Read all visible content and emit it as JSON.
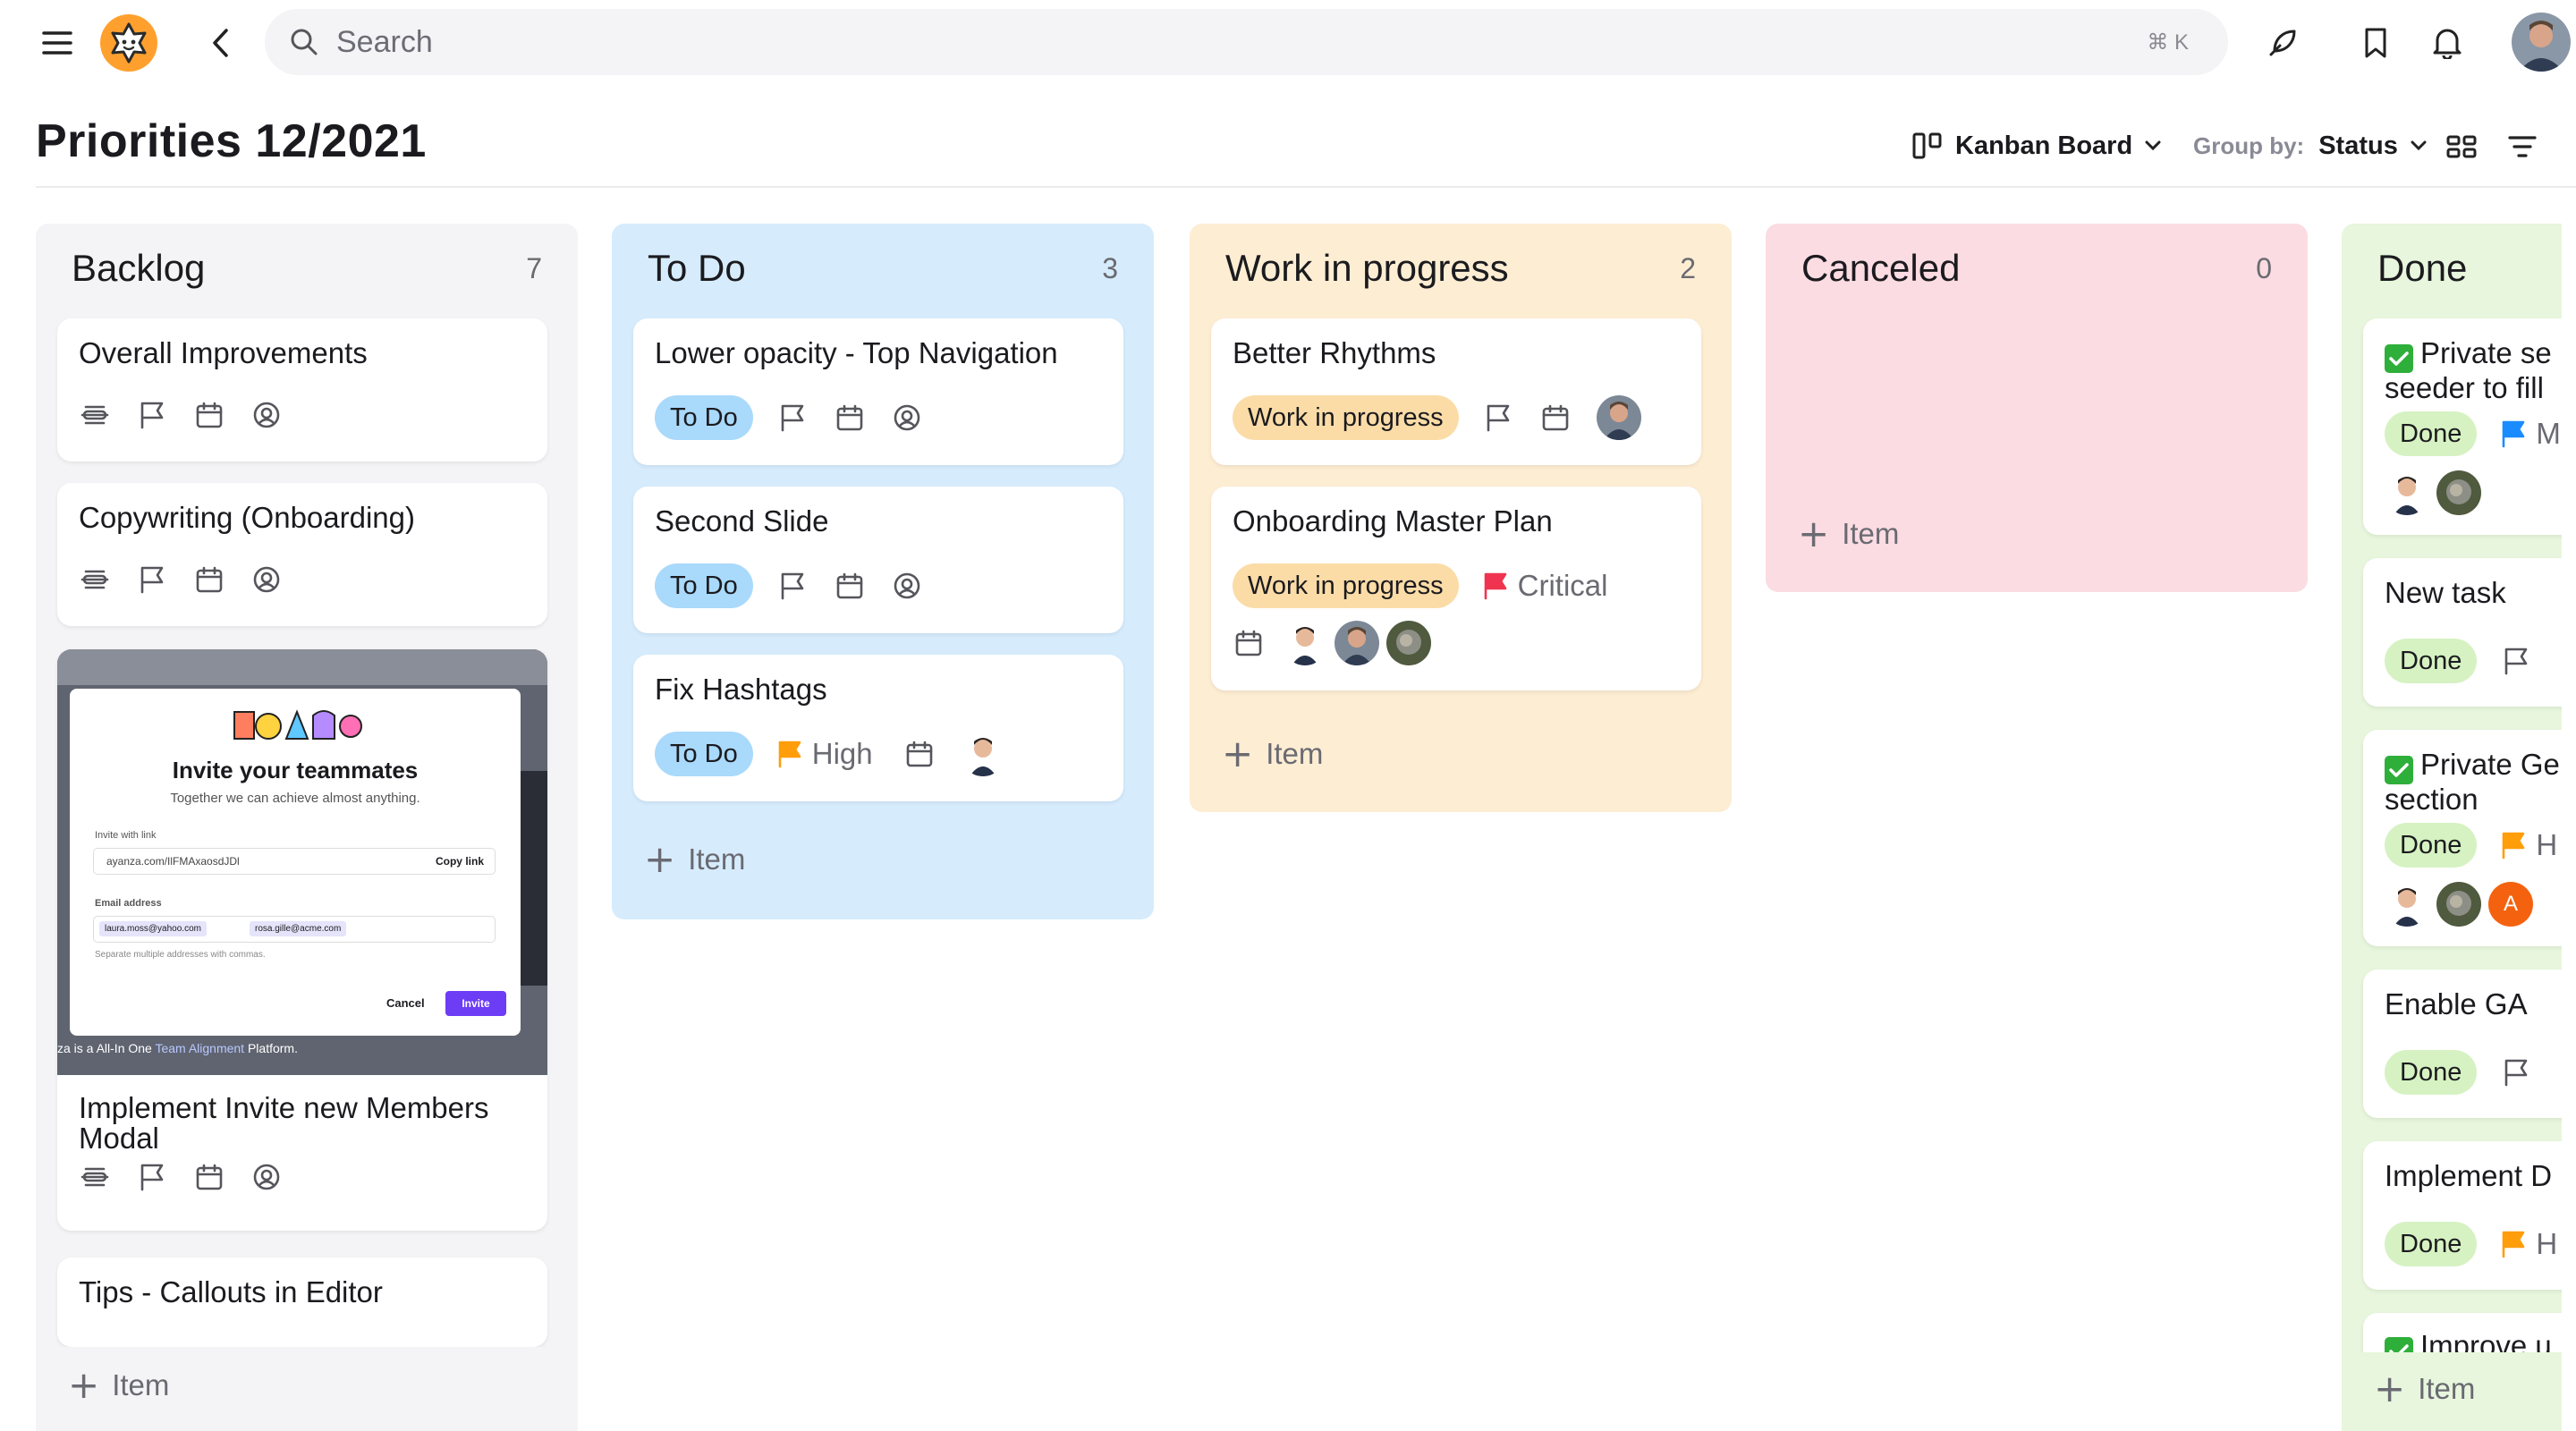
{
  "topbar": {
    "search_placeholder": "Search",
    "search_shortcut": "⌘ K"
  },
  "header": {
    "title": "Priorities 12/2021",
    "view_label": "Kanban Board",
    "group_by_label": "Group by:",
    "group_by_value": "Status"
  },
  "columns": {
    "backlog": {
      "title": "Backlog",
      "count": "7",
      "add_label": "Item",
      "cards": [
        {
          "title": "Overall Improvements"
        },
        {
          "title": "Copywriting (Onboarding)"
        },
        {
          "title": "Implement Invite new Members Modal",
          "preview": {
            "modal_title": "Invite your teammates",
            "subtitle": "Together we can achieve almost anything.",
            "link_label": "Invite with link",
            "link_value": "ayanza.com/IlFMAxaosdJDl",
            "copy_label": "Copy link",
            "email_label": "Email address",
            "chip_1": "laura.moss@yahoo.com",
            "chip_2": "rosa.gille@acme.com",
            "helper": "Separate multiple addresses with commas.",
            "cancel": "Cancel",
            "invite": "Invite",
            "footer_prefix": "za is a All-In One ",
            "footer_link": "Team Alignment",
            "footer_suffix": " Platform."
          }
        },
        {
          "title": "Tips - Callouts in Editor"
        }
      ]
    },
    "todo": {
      "title": "To Do",
      "count": "3",
      "add_label": "Item",
      "cards": [
        {
          "title": "Lower opacity - Top Navigation",
          "status": "To Do"
        },
        {
          "title": "Second Slide",
          "status": "To Do"
        },
        {
          "title": "Fix Hashtags",
          "status": "To Do",
          "priority": "High"
        }
      ]
    },
    "wip": {
      "title": "Work in progress",
      "count": "2",
      "add_label": "Item",
      "cards": [
        {
          "title": "Better Rhythms",
          "status": "Work in progress"
        },
        {
          "title": "Onboarding Master Plan",
          "status": "Work in progress",
          "priority": "Critical"
        }
      ]
    },
    "canceled": {
      "title": "Canceled",
      "count": "0",
      "add_label": "Item"
    },
    "done": {
      "title": "Done",
      "add_label": "Item",
      "cards": [
        {
          "title_line1": "Private se",
          "title_line2": "seeder to fill",
          "status": "Done",
          "priority": "M"
        },
        {
          "title": "New task",
          "status": "Done"
        },
        {
          "title_line1": "Private Ge",
          "title_line2": "section",
          "status": "Done",
          "priority": "H",
          "avatar_letter": "A"
        },
        {
          "title": "Enable GA",
          "status": "Done"
        },
        {
          "title": "Implement D",
          "status": "Done",
          "priority": "H"
        },
        {
          "title": "Improve u"
        }
      ]
    }
  },
  "colors": {
    "backlog_bg": "#f4f4f6",
    "todo_bg": "#d6ecfd",
    "wip_bg": "#fdedd3",
    "canceled_bg": "#fbdce2",
    "done_bg": "#e7f6dc",
    "flag_orange": "#ff9d0a",
    "flag_red": "#f0344f",
    "flag_blue": "#1a8cff",
    "accent_purple": "#6d3cf5"
  },
  "icons": [
    "menu-icon",
    "app-logo-icon",
    "back-icon",
    "search-icon",
    "feather-icon",
    "bookmark-icon",
    "bell-icon",
    "kanban-icon",
    "chevron-down-icon",
    "group-icon",
    "filter-icon",
    "priority-icon",
    "flag-icon",
    "calendar-icon",
    "assignee-icon",
    "plus-icon",
    "check-icon"
  ]
}
